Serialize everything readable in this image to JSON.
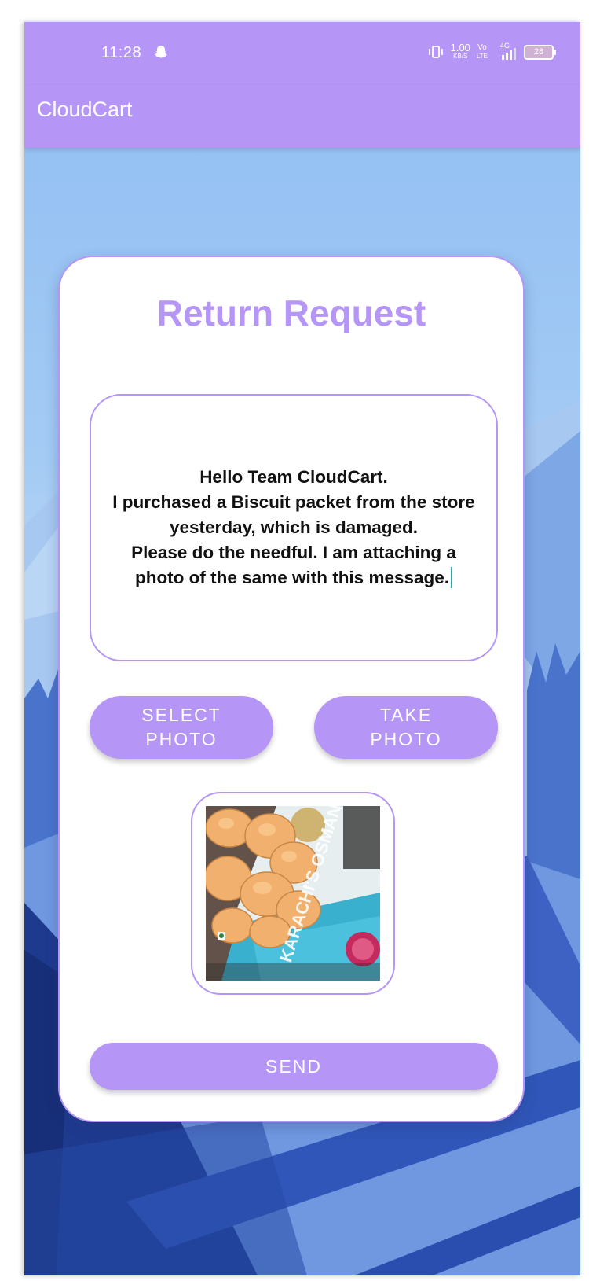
{
  "status_bar": {
    "time": "11:28",
    "net_speed_value": "1.00",
    "net_speed_unit": "KB/S",
    "volte_top": "Vo",
    "volte_bottom": "LTE",
    "network_type": "4G",
    "battery_level": "28"
  },
  "app_bar": {
    "title": "CloudCart"
  },
  "form": {
    "title": "Return Request",
    "message": "Hello Team CloudCart.\nI purchased a Biscuit packet from the store yesterday, which is damaged.\nPlease do the needful. I am attaching a photo of the same with this message.",
    "select_photo_label": "SELECT\nPHOTO",
    "take_photo_label": "TAKE\nPHOTO",
    "send_label": "SEND",
    "photo_box_text": "KARACHI'S\nOSMANIA\nBISCUITS"
  },
  "colors": {
    "accent": "#b595f5",
    "background_sky": "#9cc6f2",
    "background_mountains": "#3d62c4"
  }
}
